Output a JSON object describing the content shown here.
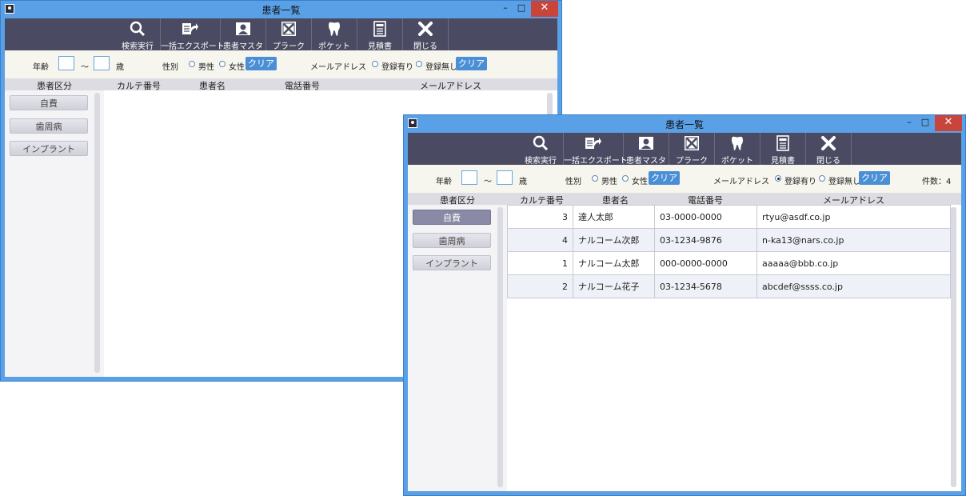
{
  "window_title": "患者一覧",
  "window_controls": {
    "minimize": "–",
    "maximize": "□",
    "close": "✕"
  },
  "toolbar": [
    {
      "id": "search",
      "label": "検索実行",
      "icon": "search-icon"
    },
    {
      "id": "export",
      "label": "一括エクスポート",
      "icon": "export-icon"
    },
    {
      "id": "patient_master",
      "label": "患者マスタ",
      "icon": "patient-card-icon"
    },
    {
      "id": "plaque",
      "label": "プラーク",
      "icon": "plaque-icon"
    },
    {
      "id": "pocket",
      "label": "ポケット",
      "icon": "tooth-icon"
    },
    {
      "id": "estimate",
      "label": "見積書",
      "icon": "document-icon"
    },
    {
      "id": "close",
      "label": "閉じる",
      "icon": "close-x-icon"
    }
  ],
  "filters": {
    "age_label": "年齢",
    "age_from": "",
    "age_sep": "～",
    "age_to": "",
    "age_unit": "歳",
    "gender_label": "性別",
    "male": "男性",
    "female": "女性",
    "clear_label": "クリア",
    "email_label": "メールアドレス",
    "has_email": "登録有り",
    "no_email": "登録無し"
  },
  "columns": {
    "category": "患者区分",
    "karte_no": "カルテ番号",
    "name": "患者名",
    "phone": "電話番号",
    "email": "メールアドレス"
  },
  "categories": [
    "自費",
    "歯周病",
    "インプラント"
  ],
  "window1": {
    "selected_category": "",
    "email_filter": ""
  },
  "window2": {
    "selected_category": "自費",
    "email_filter": "登録有り",
    "count_text": "件数：4",
    "rows": [
      {
        "karte": "3",
        "name": "達人太郎",
        "phone": "03-0000-0000",
        "email": "rtyu@asdf.co.jp"
      },
      {
        "karte": "4",
        "name": "ナルコーム次郎",
        "phone": "03-1234-9876",
        "email": "n-ka13@nars.co.jp"
      },
      {
        "karte": "1",
        "name": "ナルコーム太郎",
        "phone": "000-0000-0000",
        "email": "aaaaa@bbb.co.jp"
      },
      {
        "karte": "2",
        "name": "ナルコーム花子",
        "phone": "03-1234-5678",
        "email": "abcdef@ssss.co.jp"
      }
    ]
  }
}
